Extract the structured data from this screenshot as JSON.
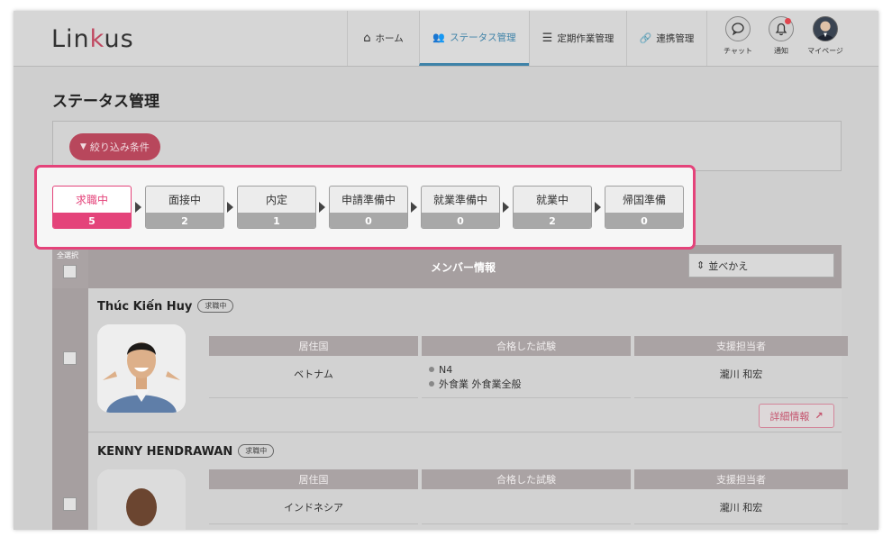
{
  "app": {
    "logo_prefix": "Lin",
    "logo_k": "k",
    "logo_suffix": "us"
  },
  "nav": [
    {
      "icon": "home-icon",
      "glyph": "⌂",
      "label": "ホーム"
    },
    {
      "icon": "users-icon",
      "glyph": "👥",
      "label": "ステータス管理"
    },
    {
      "icon": "list-icon",
      "glyph": "☰",
      "label": "定期作業管理"
    },
    {
      "icon": "link-icon",
      "glyph": "🔗",
      "label": "連携管理"
    }
  ],
  "header_icons": [
    {
      "icon": "chat-icon",
      "glyph": "◯",
      "label": "チャット"
    },
    {
      "icon": "bell-icon",
      "glyph": "🔔",
      "label": "通知"
    },
    {
      "icon": "avatar",
      "glyph": "",
      "label": "マイページ"
    }
  ],
  "page": {
    "title": "ステータス管理"
  },
  "filter": {
    "label": "絞り込み条件",
    "icon_glyph": "▼"
  },
  "statuses": [
    {
      "label": "求職中",
      "count": "5",
      "active": true
    },
    {
      "label": "面接中",
      "count": "2",
      "active": false
    },
    {
      "label": "内定",
      "count": "1",
      "active": false
    },
    {
      "label": "申請準備中",
      "count": "0",
      "active": false
    },
    {
      "label": "就業準備中",
      "count": "0",
      "active": false
    },
    {
      "label": "就業中",
      "count": "2",
      "active": false
    },
    {
      "label": "帰国準備",
      "count": "0",
      "active": false
    }
  ],
  "table": {
    "select_all_label": "全選択",
    "header": "メンバー情報",
    "sort_label": "並べかえ",
    "sort_glyph": "⇕"
  },
  "columns": {
    "country": "居住国",
    "exams": "合格した試験",
    "staff": "支援担当者"
  },
  "members": [
    {
      "name": "Thúc Kiến Huy",
      "status": "求職中",
      "country": "ベトナム",
      "exams": [
        "N4",
        "外食業 外食業全般"
      ],
      "staff": "瀧川 和宏",
      "detail_label": "詳細情報",
      "detail_glyph": "↗"
    },
    {
      "name": "KENNY HENDRAWAN",
      "status": "求職中",
      "country": "インドネシア",
      "exams": [],
      "staff": "瀧川 和宏"
    }
  ],
  "colors": {
    "accent": "#e4437a",
    "nav_active": "#3e82a8",
    "table_header": "#a69fa0"
  }
}
